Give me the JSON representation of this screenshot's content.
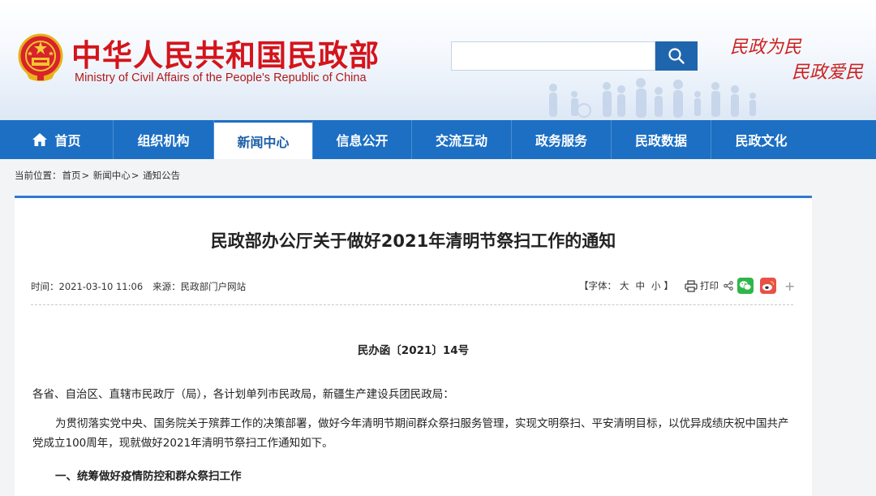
{
  "header": {
    "title_cn": "中华人民共和国民政部",
    "title_en": "Ministry of Civil Affairs of the People's Republic of China",
    "search_value": "",
    "search_icon": "search-icon",
    "slogan_line1": "民政为民",
    "slogan_line2": "民政爱民",
    "emblem_icon": "national-emblem-icon"
  },
  "nav": {
    "items": [
      {
        "label": "首页",
        "icon": "home-icon"
      },
      {
        "label": "组织机构"
      },
      {
        "label": "新闻中心",
        "active": true
      },
      {
        "label": "信息公开"
      },
      {
        "label": "交流互动"
      },
      {
        "label": "政务服务"
      },
      {
        "label": "民政数据"
      },
      {
        "label": "民政文化"
      }
    ]
  },
  "breadcrumb": {
    "prefix": "当前位置：",
    "items": [
      "首页",
      "新闻中心",
      "通知公告"
    ],
    "separator": ">"
  },
  "article": {
    "title": "民政部办公厅关于做好2021年清明节祭扫工作的通知",
    "time_label": "时间：",
    "time": "2021-03-10 11:06",
    "source_label": "来源：",
    "source": "民政部门户网站",
    "font_prefix": "【字体：",
    "font_large": "大",
    "font_medium": "中",
    "font_small": "小",
    "font_suffix": "】",
    "print_label": "打印",
    "doc_number": "民办函〔2021〕14号",
    "addressee": "各省、自治区、直辖市民政厅（局），各计划单列市民政局，新疆生产建设兵团民政局：",
    "para1_line1": "为贯彻落实党中央、国务院关于殡葬工作的决策部署，做好今年清明节期间群众祭扫服务管理，实现文明祭扫、平安清明目标，以优异成绩庆祝中国共产",
    "para1_line2": "党成立100周年，现就做好2021年清明节祭扫工作通知如下。",
    "section1": "一、统筹做好疫情防控和群众祭扫工作"
  },
  "colors": {
    "nav_blue": "#1c6fc3",
    "title_red": "#d4141b",
    "search_blue": "#1f65ad",
    "wechat_green": "#2fb64a",
    "weibo_red": "#e8514a"
  }
}
